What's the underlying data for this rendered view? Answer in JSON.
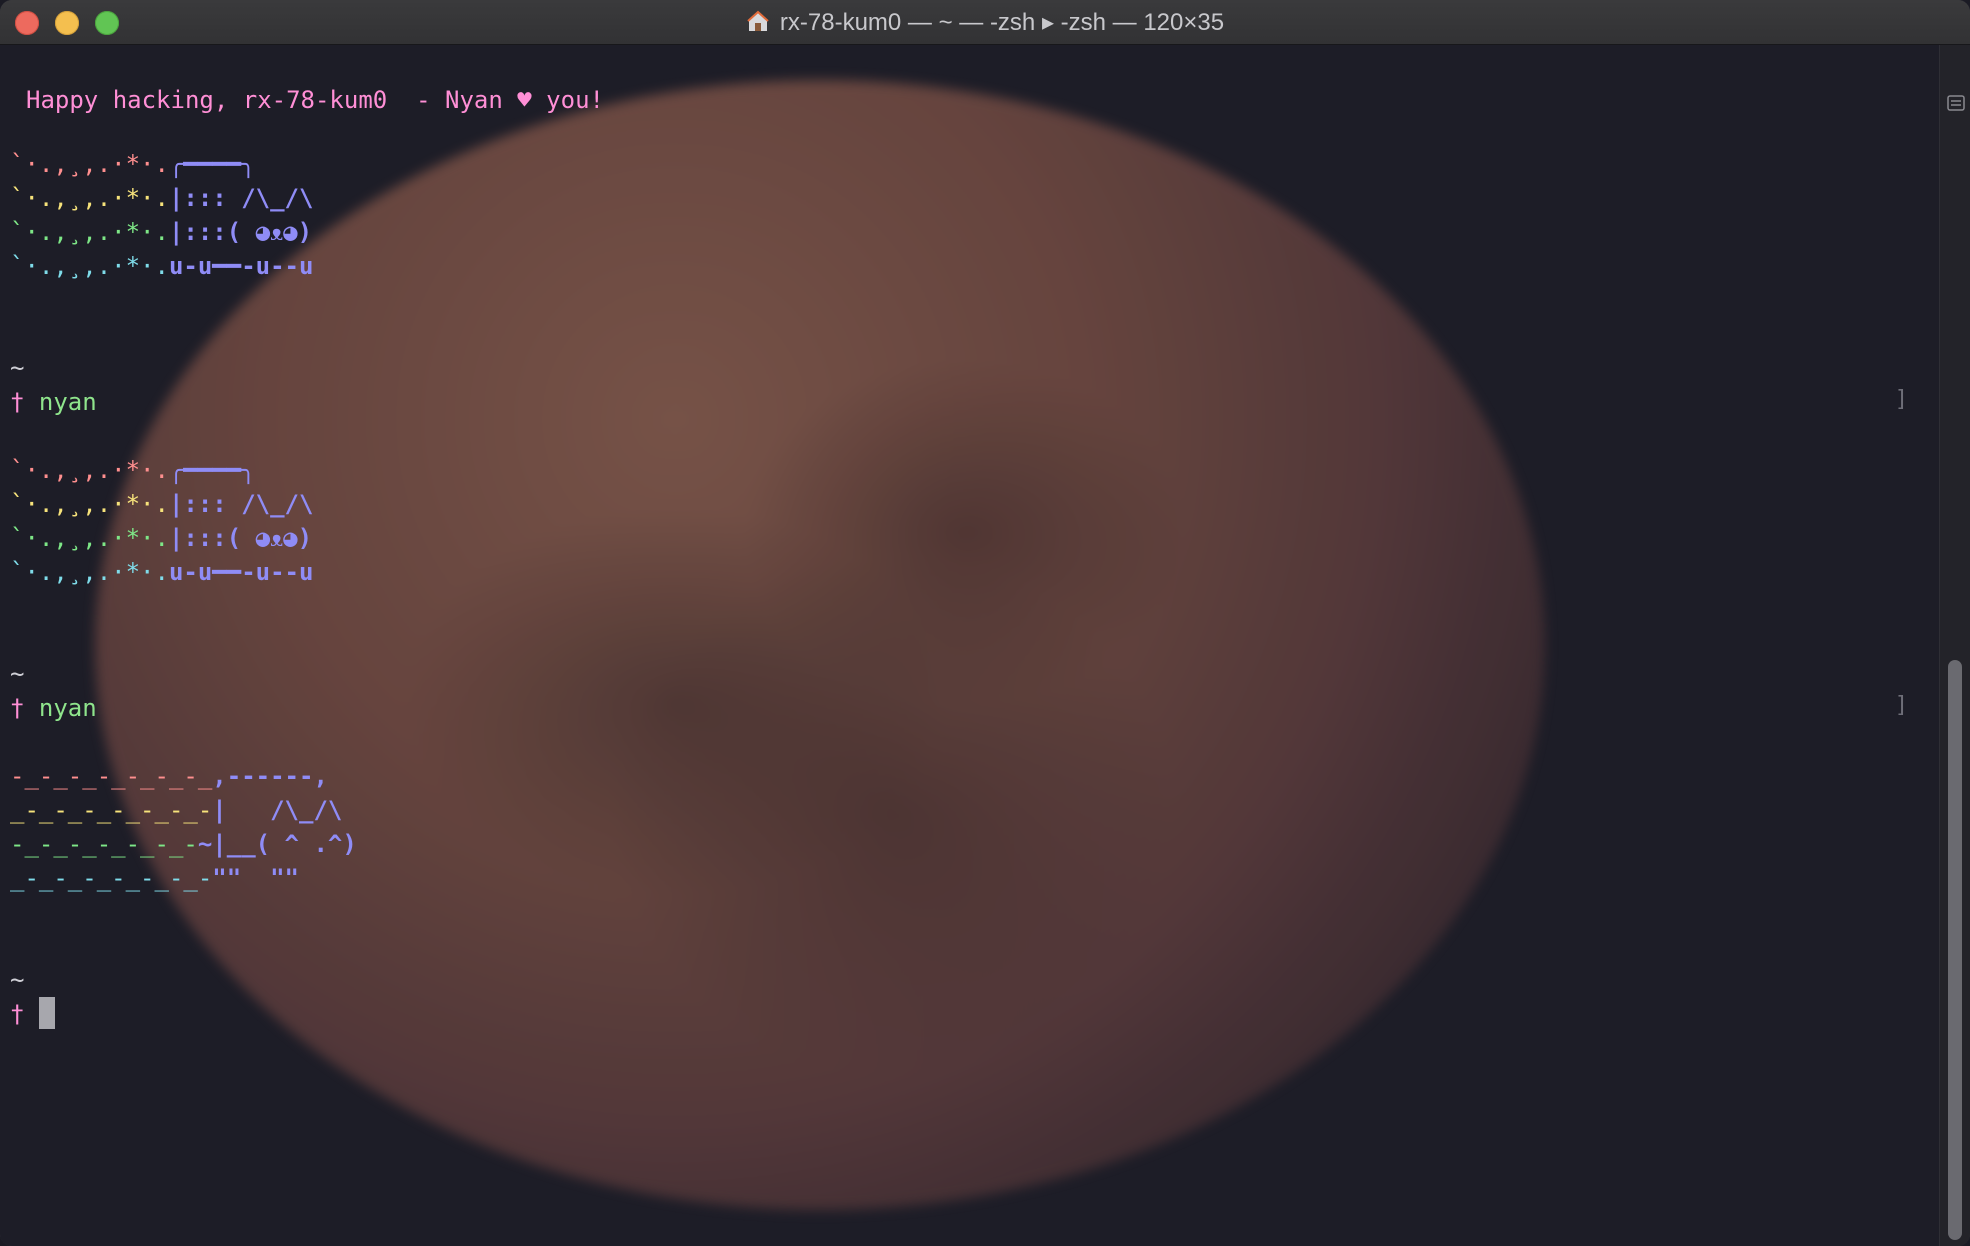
{
  "window": {
    "title": "rx-78-kum0 — ~ — -zsh ▸ -zsh — 120×35"
  },
  "terminal": {
    "motd": "Happy hacking, rx-78-kum0  - Nyan ♥ you!",
    "prompt_symbol": "†",
    "cwd": "~",
    "commands": [
      "nyan",
      "nyan"
    ],
    "nyan1": {
      "rows": [
        {
          "trail": "`·.,¸,.·*·.",
          "body": "╭━━━━╮"
        },
        {
          "trail": "`·.,¸,.·*·.",
          "body": "|::: /\\_/\\"
        },
        {
          "trail": "`·.,¸,.·*·.",
          "body": "|:::( ◕ᴥ◕)"
        },
        {
          "trail": "`·.,¸,.·*·.",
          "body": "u-u━━-u--u"
        }
      ]
    },
    "nyan2": {
      "rows": [
        {
          "trail": "-_-_-_-_-_-_-_",
          "body": ",------,"
        },
        {
          "trail": "_-_-_-_-_-_-_-",
          "body": "|   /\\_/\\"
        },
        {
          "trail": "-_-_-_-_-_-_-",
          "body": "~|__( ^ .^)"
        },
        {
          "trail": "_-_-_-_-_-_-_-",
          "body": "\"\"  \"\""
        }
      ]
    }
  },
  "icons": {
    "home": "home-folder-icon",
    "split": "split-pane-icon"
  },
  "colors": {
    "prompt": "#ff8fd6",
    "command": "#8fe58c",
    "cat": "#8f8cf6",
    "background": "#1d1d27"
  }
}
